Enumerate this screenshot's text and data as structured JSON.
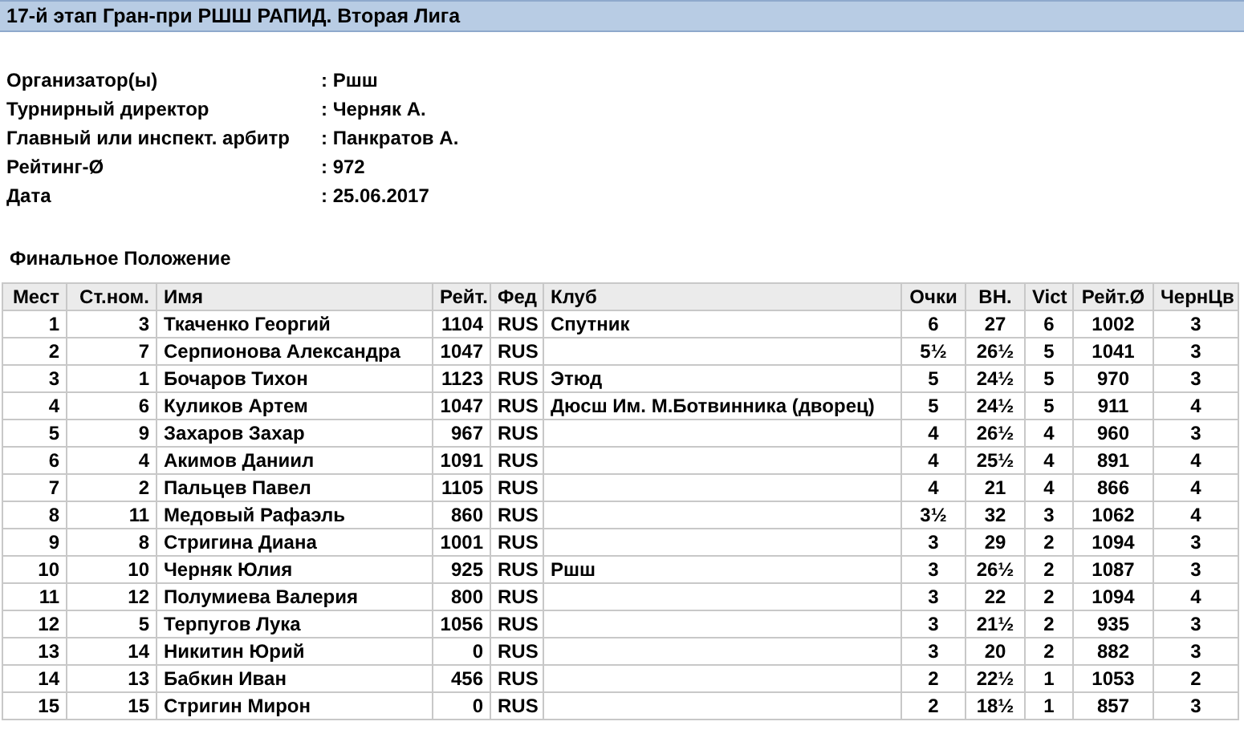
{
  "title": "17-й этап Гран-при РШШ РАПИД. Вторая Лига",
  "info": [
    {
      "label": "Организатор(ы)",
      "value": ": Ршш"
    },
    {
      "label": "Турнирный директор",
      "value": ": Черняк А."
    },
    {
      "label": "Главный или инспект. арбитр",
      "value": ": Панкратов А."
    },
    {
      "label": "Рейтинг-Ø",
      "value": ": 972"
    },
    {
      "label": "Дата",
      "value": ": 25.06.2017"
    }
  ],
  "section_title": "Финальное Положение",
  "table": {
    "columns": [
      "Мест",
      "Ст.ном.",
      "Имя",
      "Рейт.",
      "Фед",
      "Клуб",
      "Очки",
      "ВН.",
      "Vict",
      "Рейт.Ø",
      "ЧернЦв"
    ],
    "rows": [
      [
        "1",
        "3",
        "Ткаченко Георгий",
        "1104",
        "RUS",
        "Спутник",
        "6",
        "27",
        "6",
        "1002",
        "3"
      ],
      [
        "2",
        "7",
        "Серпионова Александра",
        "1047",
        "RUS",
        "",
        "5½",
        "26½",
        "5",
        "1041",
        "3"
      ],
      [
        "3",
        "1",
        "Бочаров Тихон",
        "1123",
        "RUS",
        "Этюд",
        "5",
        "24½",
        "5",
        "970",
        "3"
      ],
      [
        "4",
        "6",
        "Куликов Артем",
        "1047",
        "RUS",
        "Дюсш Им. М.Ботвинника (дворец)",
        "5",
        "24½",
        "5",
        "911",
        "4"
      ],
      [
        "5",
        "9",
        "Захаров Захар",
        "967",
        "RUS",
        "",
        "4",
        "26½",
        "4",
        "960",
        "3"
      ],
      [
        "6",
        "4",
        "Акимов Даниил",
        "1091",
        "RUS",
        "",
        "4",
        "25½",
        "4",
        "891",
        "4"
      ],
      [
        "7",
        "2",
        "Пальцев Павел",
        "1105",
        "RUS",
        "",
        "4",
        "21",
        "4",
        "866",
        "4"
      ],
      [
        "8",
        "11",
        "Медовый Рафаэль",
        "860",
        "RUS",
        "",
        "3½",
        "32",
        "3",
        "1062",
        "4"
      ],
      [
        "9",
        "8",
        "Стригина Диана",
        "1001",
        "RUS",
        "",
        "3",
        "29",
        "2",
        "1094",
        "3"
      ],
      [
        "10",
        "10",
        "Черняк Юлия",
        "925",
        "RUS",
        "Ршш",
        "3",
        "26½",
        "2",
        "1087",
        "3"
      ],
      [
        "11",
        "12",
        "Полумиева Валерия",
        "800",
        "RUS",
        "",
        "3",
        "22",
        "2",
        "1094",
        "4"
      ],
      [
        "12",
        "5",
        "Терпугов Лука",
        "1056",
        "RUS",
        "",
        "3",
        "21½",
        "2",
        "935",
        "3"
      ],
      [
        "13",
        "14",
        "Никитин Юрий",
        "0",
        "RUS",
        "",
        "3",
        "20",
        "2",
        "882",
        "3"
      ],
      [
        "14",
        "13",
        "Бабкин Иван",
        "456",
        "RUS",
        "",
        "2",
        "22½",
        "1",
        "1053",
        "2"
      ],
      [
        "15",
        "15",
        "Стригин Мирон",
        "0",
        "RUS",
        "",
        "2",
        "18½",
        "1",
        "857",
        "3"
      ]
    ]
  }
}
